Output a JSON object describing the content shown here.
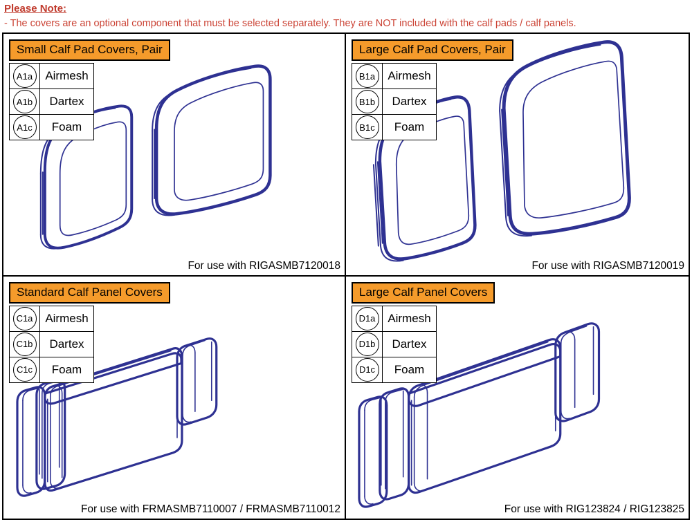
{
  "note": {
    "title": "Please Note:",
    "line1": "- The covers are an optional component that must be selected separately. They are NOT included with the calf pads / calf panels."
  },
  "colors": {
    "header_orange": "#F59B2B",
    "note_red": "#cb4335",
    "drawing_blue": "#2E3192",
    "border_black": "#000000"
  },
  "panels": [
    {
      "id": "small-calf-pad-covers",
      "title": "Small Calf Pad Covers, Pair",
      "rows": [
        {
          "code": "A1a",
          "label": "Airmesh"
        },
        {
          "code": "A1b",
          "label": "Dartex"
        },
        {
          "code": "A1c",
          "label": "Foam"
        }
      ],
      "footer": "For use with RIGASMB7120018",
      "drawing": "pair-of-calf-pad-covers"
    },
    {
      "id": "large-calf-pad-covers",
      "title": "Large Calf Pad Covers, Pair",
      "rows": [
        {
          "code": "B1a",
          "label": "Airmesh"
        },
        {
          "code": "B1b",
          "label": "Dartex"
        },
        {
          "code": "B1c",
          "label": "Foam"
        }
      ],
      "footer": "For use with RIGASMB7120019",
      "drawing": "pair-of-large-calf-pad-covers"
    },
    {
      "id": "standard-calf-panel-covers",
      "title": "Standard Calf Panel Covers",
      "rows": [
        {
          "code": "C1a",
          "label": "Airmesh"
        },
        {
          "code": "C1b",
          "label": "Dartex"
        },
        {
          "code": "C1c",
          "label": "Foam"
        }
      ],
      "footer": "For use with FRMASMB7110007 / FRMASMB7110012",
      "drawing": "calf-panel-cover-isometric"
    },
    {
      "id": "large-calf-panel-covers",
      "title": "Large Calf Panel Covers",
      "rows": [
        {
          "code": "D1a",
          "label": "Airmesh"
        },
        {
          "code": "D1b",
          "label": "Dartex"
        },
        {
          "code": "D1c",
          "label": "Foam"
        }
      ],
      "footer": "For use with RIG123824 / RIG123825",
      "drawing": "large-calf-panel-cover-isometric"
    }
  ]
}
